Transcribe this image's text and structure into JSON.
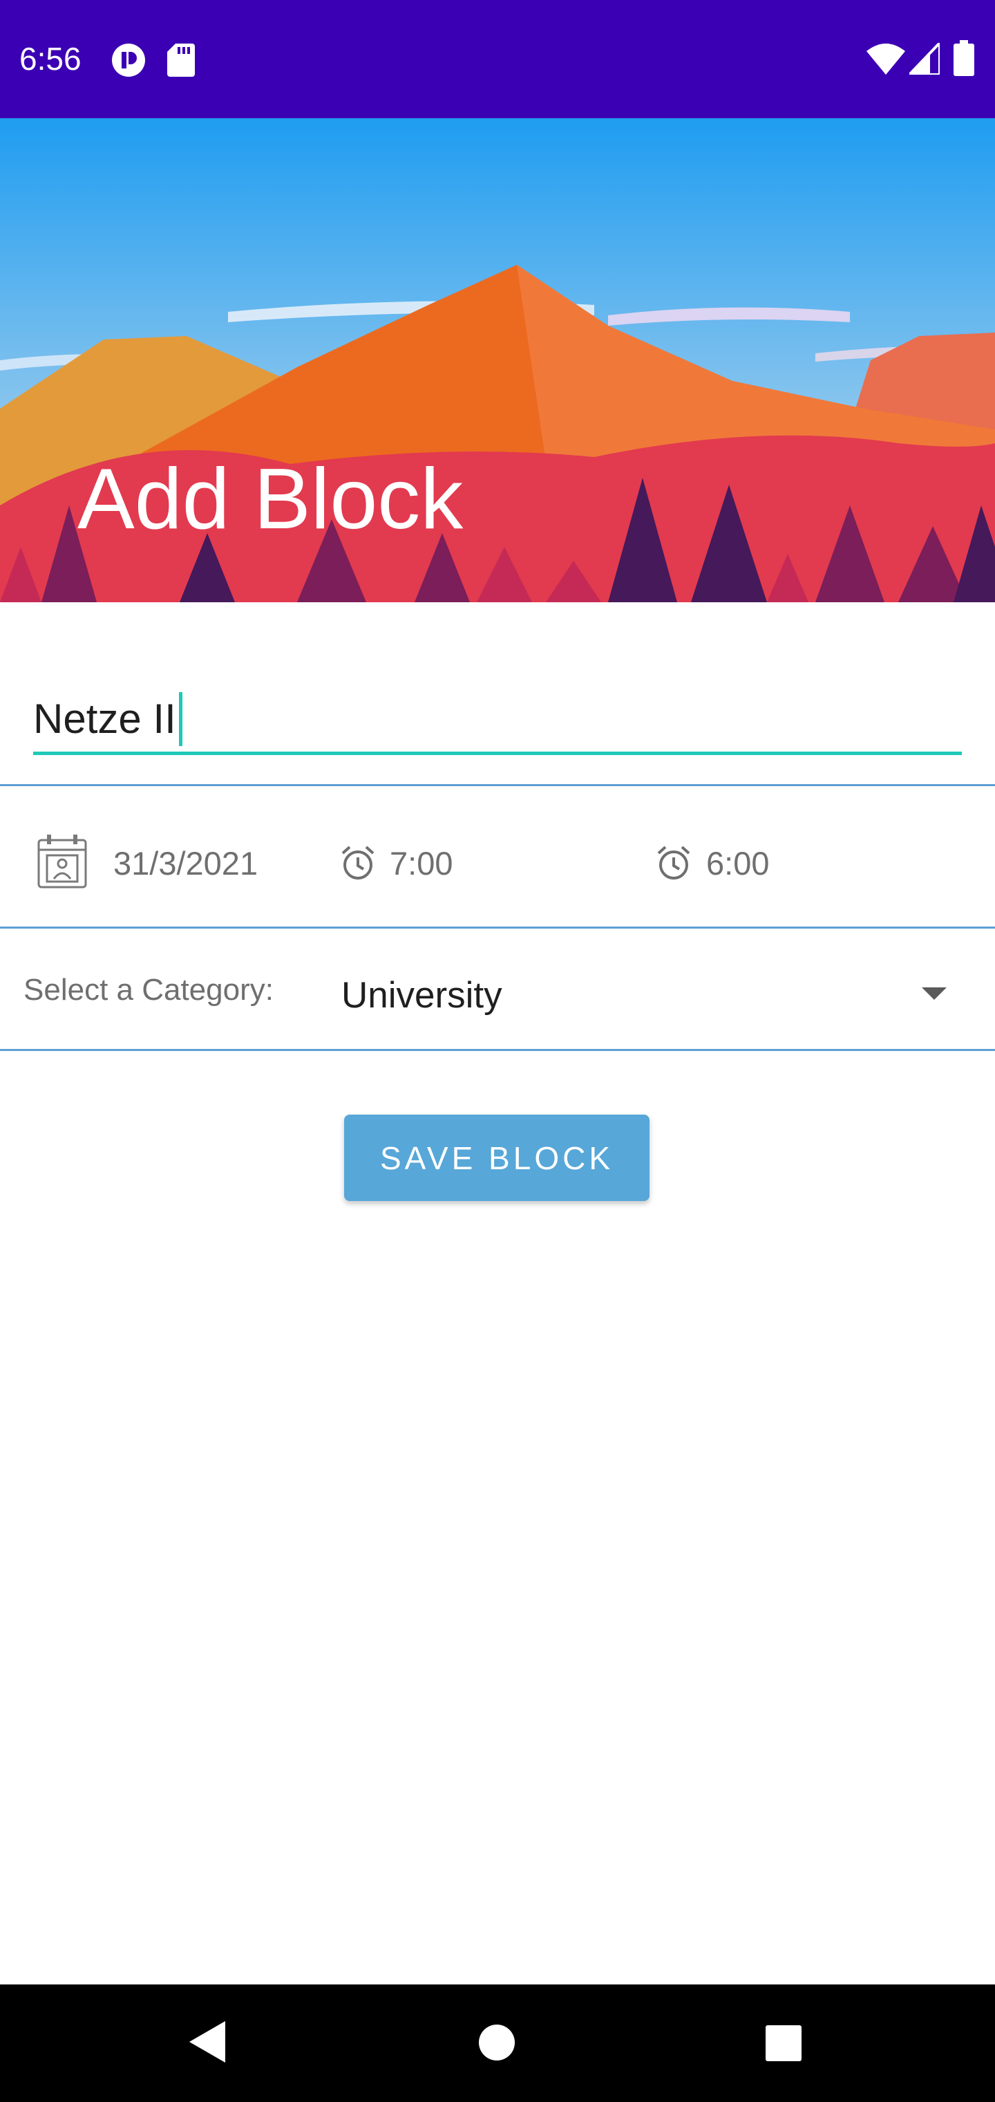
{
  "status_bar": {
    "time": "6:56",
    "background": "#3c00b4",
    "left_icons": [
      "media-notification-icon",
      "sd-card-icon"
    ],
    "right_icons": [
      "wifi-icon",
      "cell-signal-icon",
      "battery-icon"
    ]
  },
  "header": {
    "title": "Add Block"
  },
  "form": {
    "name_value": "Netze II",
    "accent_color": "#1ec9b8",
    "date": "31/3/2021",
    "start_time": "7:00",
    "end_time": "6:00",
    "category_label": "Select a Category:",
    "category_value": "University",
    "save_label": "SAVE BLOCK",
    "save_color": "#57a7d8"
  },
  "nav_bar": {
    "icons": [
      "back-icon",
      "home-icon",
      "recents-icon"
    ]
  }
}
